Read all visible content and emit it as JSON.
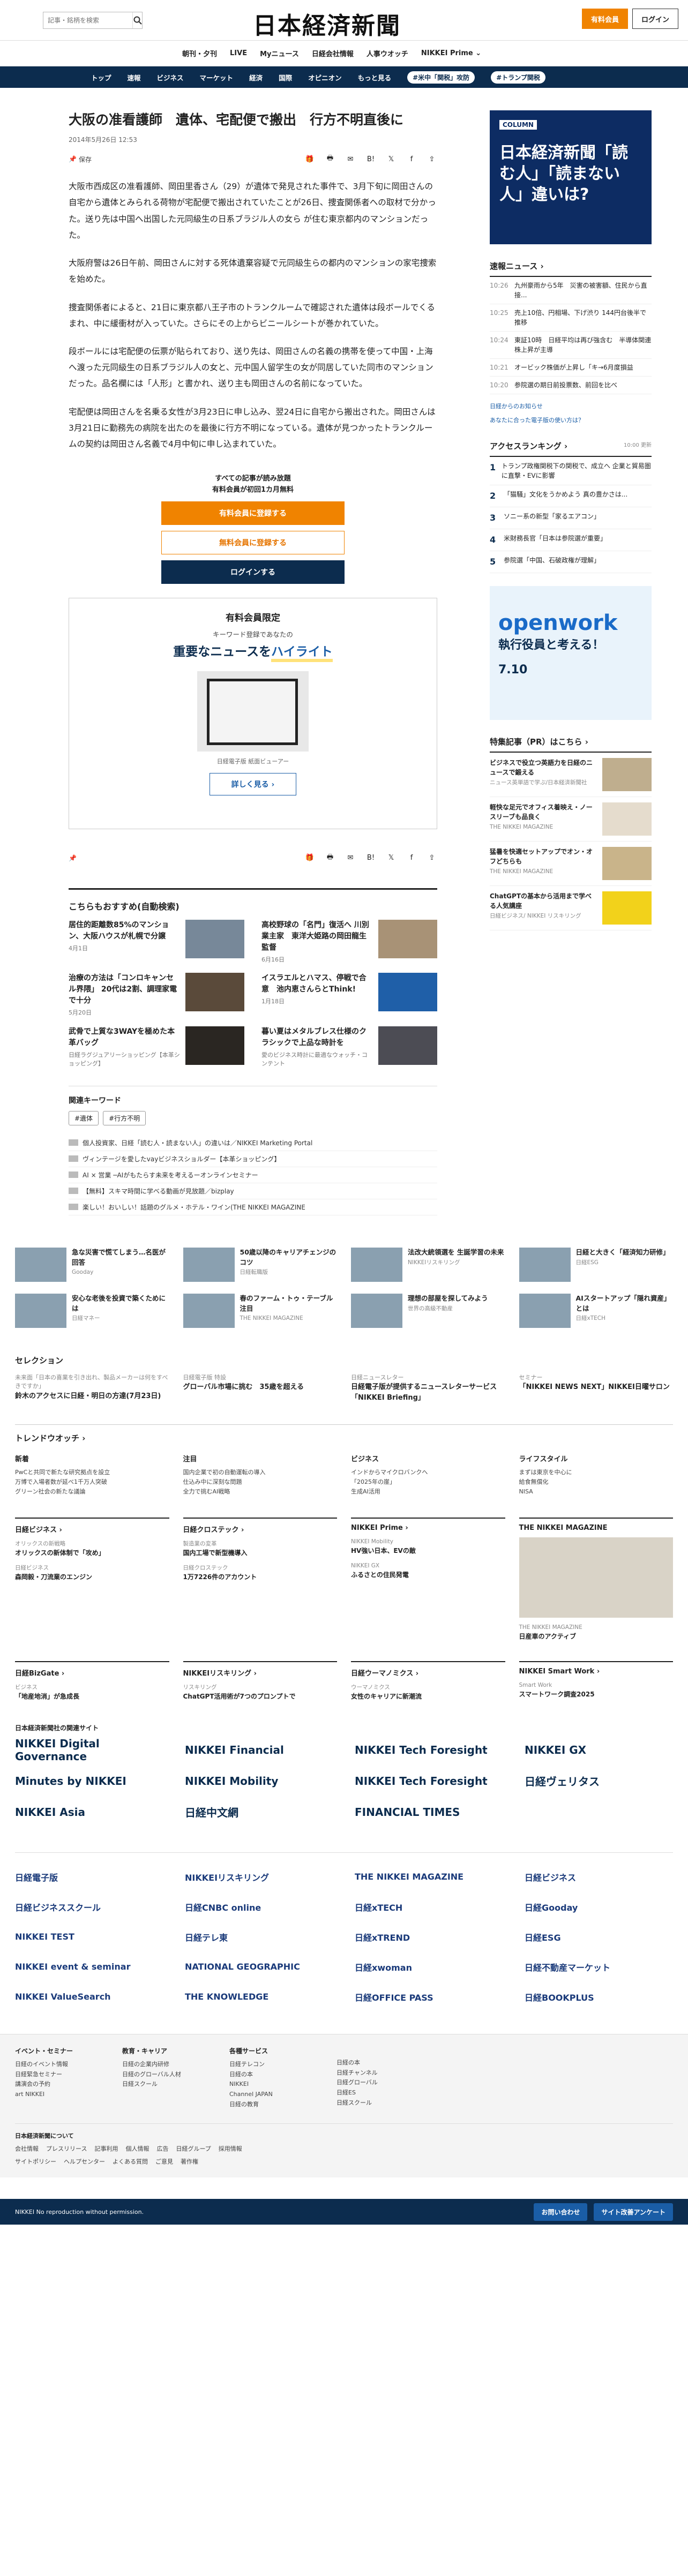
{
  "header": {
    "search_placeholder": "記事・銘柄を検索",
    "logo": "日本経済新聞",
    "subscribe": "有料会員",
    "login": "ログイン"
  },
  "subnav": [
    "朝刊・夕刊",
    "LIVE",
    "Myニュース",
    "日経会社情報",
    "人事ウオッチ",
    "NIKKEI Prime ⌄"
  ],
  "gnav": [
    "トップ",
    "速報",
    "ビジネス",
    "マーケット",
    "経済",
    "国際",
    "オピニオン",
    "もっと見る"
  ],
  "gnav_tags": [
    "#米中「関税」攻防",
    "#トランプ関税"
  ],
  "article": {
    "title": "大阪の准看護師　遺体、宅配便で搬出　行方不明直後に",
    "date": "2014年5月26日 12:53",
    "save": "保存",
    "paragraphs": [
      "大阪市西成区の准看護師、岡田里香さん（29）が遺体で発見された事件で、3月下旬に岡田さんの自宅から遺体とみられる荷物が宅配便で搬出されていたことが26日、捜査関係者への取材で分かった。送り先は中国へ出国した元同級生の日系ブラジル人の女ら が住む東京都内のマンションだった。",
      "大阪府警は26日午前、岡田さんに対する死体遺棄容疑で元同級生らの都内のマンションの家宅捜索を始めた。",
      "捜査関係者によると、21日に東京都八王子市のトランクルームで確認された遺体は段ボールでくるまれ、中に緩衝材が入っていた。さらにその上からビニールシートが巻かれていた。",
      "段ボールには宅配便の伝票が貼られており、送り先は、岡田さんの名義の携帯を使って中国・上海へ渡った元同級生の日系ブラジル人の女と、元中国人留学生の女が同居していた同市のマンションだった。品名欄には「人形」と書かれ、送り主も岡田さんの名前になっていた。",
      "宅配便は岡田さんを名乗る女性が3月23日に申し込み、翌24日に自宅から搬出された。岡田さんは3月21日に勤務先の病院を出たのを最後に行方不明になっている。遺体が見つかったトランクルームの契約は岡田さん名義で4月中旬に申し込まれていた。"
    ]
  },
  "gate": {
    "msg1": "すべての記事が読み放題",
    "msg2": "有料会員が初回1カ月無料",
    "btn1": "有料会員に登録する",
    "btn2": "無料会員に登録する",
    "btn3": "ログインする"
  },
  "promo": {
    "t1": "有料会員限定",
    "t2": "キーワード登録であなたの",
    "t3a": "重要なニュースを",
    "t3b": "ハイライト",
    "cap": "日経電子版 紙面ビューアー",
    "more": "詳しく見る ›"
  },
  "rec": {
    "heading": "こちらもおすすめ(自動検索)",
    "items": [
      {
        "t": "居住的距離数85%のマンション、大阪ハウスが札幌で分譲",
        "s": "4月1日"
      },
      {
        "t": "高校野球の「名門」復活へ 川別業主家　東洋大姫路の岡田龍生監督",
        "s": "6月16日"
      },
      {
        "t": "治療の方法は「コンロキャンセル界隈」 20代は2割、調理家電で十分",
        "s": "5月20日"
      },
      {
        "t": "イスラエルとハマス、停戦で合意　池内恵さんらとThink!",
        "s": "1月18日"
      },
      {
        "t": "武骨で上質な3WAYを極めた本革バッグ",
        "s": "日経ラグジュアリーショッピング【本革ショッピング】"
      },
      {
        "t": "暮い夏はメタルブレス仕様のクラシックで上品な時計を",
        "s": "愛のビジネス時計に最適なウォッチ・コンテント"
      }
    ]
  },
  "keywords": {
    "heading": "関連キーワード",
    "chips": [
      "#遺体",
      "#行方不明"
    ]
  },
  "prlinks": [
    "個人投資家、日経「読む人・読まない人」の違いは／NIKKEI Marketing Portal",
    "ヴィンテージを愛したvayビジネスショルダー【本革ショッピング】",
    "AI × 営業 ─AIがもたらす未来を考えるーオンラインセミナー",
    "【無料】スキマ時間に学べる動画が見放題／bizplay",
    "楽しい！おいしい！話題のグルメ・ホテル・ワイン(THE NIKKEI MAGAZINE"
  ],
  "side": {
    "ad1_cat": "COLUMN",
    "ad1_big": "日本経済新聞「読む人」「読まない人」違いは?",
    "news_h": "速報ニュース ›",
    "news": [
      {
        "t": "10:26",
        "s": "九州豪雨から5年　災害の被害額、住民から直接..."
      },
      {
        "t": "10:25",
        "s": "売上10倍、円相場、下げ渋り 144円台後半で推移"
      },
      {
        "t": "10:24",
        "s": "東証10時　日経平均は再び強含む　半導体関連株上昇が主導"
      },
      {
        "t": "10:21",
        "s": "オービック株価が上昇し「キ→6月度損益"
      },
      {
        "t": "10:20",
        "s": "参院選の期日前投票数、前回を比べ"
      }
    ],
    "link_a": "日経からのお知らせ",
    "link_b": "あなたに合った電子版の使い方は？",
    "rank_h": "アクセスランキング ›",
    "rank_time": "10:00 更新",
    "rank": [
      "トランプ政権関税下の関税で、成立へ 企業と貿易圏に直撃・EVに影響",
      "「猫騒」文化をうかめよう 真の豊かさは...",
      "ソニー系の新型「家るエアコン」",
      "米財務長官「日本は参院選が重要」",
      "参院選「中国、石破政権が理解」"
    ],
    "ad2_top": "openwork",
    "ad2_big": "執行役員と考える！",
    "ad2_date": "7.10",
    "pr_h": "特集記事（PR）はこちら ›",
    "pr": [
      {
        "t": "ビジネスで役立つ英語力を日経のニュースで鍛える",
        "s": "ニュース英単語で学ぶ/日本経済新聞社"
      },
      {
        "t": "軽快な足元でオフィス着映え・ノースリーブも品良く",
        "s": "THE NIKKEI MAGAZINE"
      },
      {
        "t": "猛暑を快適セットアップでオン・オフどちらも",
        "s": "THE NIKKEI MAGAZINE"
      },
      {
        "t": "ChatGPTの基本から活用まで学べる人気講座",
        "s": "日経ビジネス/ NIKKEI リスキリング"
      }
    ]
  },
  "row4": [
    {
      "t": "急な災害で慌てしまう…名医が回答",
      "s": "Gooday"
    },
    {
      "t": "50歳以降のキャリアチェンジのコツ",
      "s": "日経転職版"
    },
    {
      "t": "法改大統領選を 生誕学習の未来",
      "s": "NIKKEIリスキリング"
    },
    {
      "t": "日経と大きく「経済知力研修」",
      "s": "日経ESG"
    },
    {
      "t": "安心な老後を投資で築くためには",
      "s": "日経マネー"
    },
    {
      "t": "春のファーム・トゥ・テーブル注目",
      "s": "THE NIKKEI MAGAZINE"
    },
    {
      "t": "理想の部屋を探してみよう",
      "s": "世界の高級不動産"
    },
    {
      "t": "AIスタートアップ「隠れ資産」とは",
      "s": "日経xTECH"
    }
  ],
  "selection": {
    "heading": "セレクション",
    "items": [
      {
        "s": "未来面「日本の喜業を引き出れ、製品メーカーは何をすべきですか」",
        "t": "鈴木のアクセスに日経・明日の方達(7月23日)"
      },
      {
        "s": "日経電子版 特設",
        "t": "グローバル市場に挑む　35歳を超える"
      },
      {
        "s": "日経ニュースレター",
        "t": "日経電子版が提供するニュースレターサービス「NIKKEI Briefing」"
      },
      {
        "s": "セミナー",
        "t": "「NIKKEI NEWS NEXT」NIKKEI日曜サロン"
      }
    ]
  },
  "trend": {
    "heading": "トレンドウオッチ ›",
    "cols": [
      {
        "h": "新着",
        "l": [
          "PwCと共同で新たな研究拠点を設立",
          "万博で入場者数が延べ1千万人突破",
          "グリーン社会の新たな議論"
        ]
      },
      {
        "h": "注目",
        "l": [
          "国内企業で初の自動運転の導入",
          "仕込み中に深刻な問題",
          "全力で挑むAI戦略"
        ]
      },
      {
        "h": "ビジネス",
        "l": [
          "インドからマイクロバンクへ",
          "「2025年の崖」",
          "生成AI活用"
        ]
      },
      {
        "h": "ライフスタイル",
        "l": [
          "まずは東京を中心に",
          "給食無償化",
          "NISA"
        ]
      }
    ]
  },
  "pubs": [
    {
      "h": "日経ビジネス ›",
      "i": [
        {
          "s": "オリックスの新戦略",
          "t": "オリックスの新体制で「攻め」"
        },
        {
          "s": "日経ビジネス",
          "t": "森岡毅・刀流業のエンジン"
        }
      ]
    },
    {
      "h": "日経クロステック ›",
      "i": [
        {
          "s": "製造業の変革",
          "t": "国内工場で新型機導入"
        },
        {
          "s": "日経クロステック",
          "t": "1万7226件のアカウント"
        }
      ]
    },
    {
      "h": "NIKKEI Prime ›",
      "i": [
        {
          "s": "NIKKEI Mobility",
          "t": "HV強い日本、EVの敵"
        },
        {
          "s": "NIKKEI GX",
          "t": "ふるさとの住民発電"
        }
      ]
    },
    {
      "h": "THE NIKKEI MAGAZINE",
      "i": [
        {
          "s": "",
          "t": ""
        },
        {
          "s": "THE NIKKEI MAGAZINE",
          "t": "日産車のアクティブ"
        }
      ]
    },
    {
      "h": "日経BizGate ›",
      "i": [
        {
          "s": "ビジネス",
          "t": "「地産地消」が急成長"
        }
      ]
    },
    {
      "h": "NIKKEIリスキリング ›",
      "i": [
        {
          "s": "リスキリング",
          "t": "ChatGPT活用術が7つのプロンプトで"
        }
      ]
    },
    {
      "h": "日経ウーマノミクス ›",
      "i": [
        {
          "s": "ウーマノミクス",
          "t": "女性のキャリアに新潮流"
        }
      ]
    },
    {
      "h": "NIKKEI Smart Work ›",
      "i": [
        {
          "s": "Smart Work",
          "t": "スマートワーク調査2025"
        }
      ]
    }
  ],
  "svc_h": "日本経済新聞社の関連サイト",
  "svc": [
    "NIKKEI Digital Governance",
    "NIKKEI Financial",
    "NIKKEI Tech Foresight",
    "NIKKEI GX",
    "Minutes by NIKKEI",
    "NIKKEI Mobility",
    "NIKKEI Tech Foresight",
    "日経ヴェリタス",
    "NIKKEI Asia",
    "日経中文網",
    "FINANCIAL TIMES",
    ""
  ],
  "logos": [
    "日経電子版",
    "NIKKEIリスキリング",
    "THE NIKKEI MAGAZINE",
    "日経ビジネス",
    "日経ビジネススクール",
    "日経CNBC online",
    "日経xTECH",
    "日経Gooday",
    "NIKKEI TEST",
    "日経テレ東",
    "日経xTREND",
    "日経ESG",
    "NIKKEI event & seminar",
    "NATIONAL GEOGRAPHIC",
    "日経xwoman",
    "日経不動産マーケット",
    "NIKKEI ValueSearch",
    "THE KNOWLEDGE",
    "日経OFFICE PASS",
    "日経BOOKPLUS"
  ],
  "footer": {
    "cols": [
      {
        "h": "イベント・セミナー",
        "l": [
          "日経のイベント情報",
          "日経緊急セミナー",
          "講演会の予約",
          "art NIKKEI"
        ]
      },
      {
        "h": "教育・キャリア",
        "l": [
          "日経の企業内研修",
          "日経のグローバル人材",
          "日経スクール"
        ]
      },
      {
        "h": "各種サービス",
        "l": [
          "日経テレコン",
          "日経の本",
          "NIKKEI",
          "Channel JAPAN",
          "日経の教育"
        ]
      },
      {
        "h": "",
        "l": [
          "日経の本",
          "日経チャンネル",
          "日経グローバル",
          "日経ES",
          "日経スクール"
        ]
      }
    ],
    "company": "日本経済新聞について",
    "links": [
      "会社情報",
      "プレスリリース",
      "記事利用",
      "個人情報",
      "広告",
      "日経グループ",
      "採用情報"
    ],
    "links2": [
      "サイトポリシー",
      "ヘルプセンター",
      "よくある質問",
      "ご意見",
      "著作権"
    ],
    "copy": "NIKKEI  No reproduction without permission.",
    "btnA": "お問い合わせ",
    "btnB": "サイト改善アンケート"
  }
}
